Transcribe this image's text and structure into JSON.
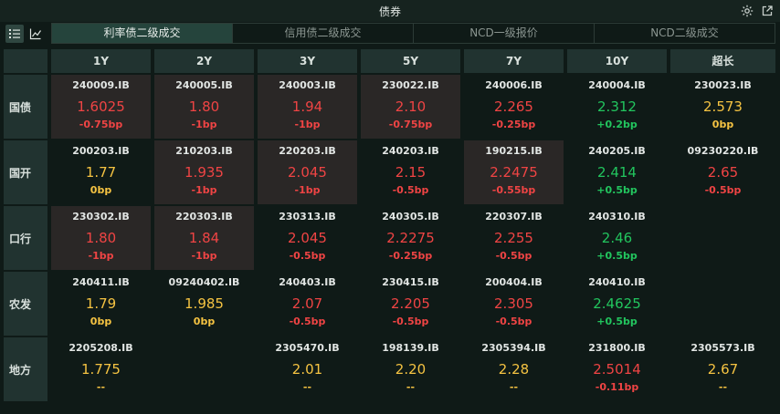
{
  "window": {
    "title": "债券"
  },
  "tabs": [
    {
      "label": "利率债二级成交",
      "active": true
    },
    {
      "label": "信用债二级成交",
      "active": false
    },
    {
      "label": "NCD一级报价",
      "active": false
    },
    {
      "label": "NCD二级成交",
      "active": false
    }
  ],
  "colors": {
    "up": "#ef4444",
    "down": "#22c55e",
    "flat": "#f5c342",
    "background": "#0f1a17",
    "header": "#213330",
    "tab_active": "#25443c"
  },
  "columns": [
    "1Y",
    "2Y",
    "3Y",
    "5Y",
    "7Y",
    "10Y",
    "超长"
  ],
  "rows": [
    {
      "name": "国债",
      "cells": [
        {
          "code": "240009.IB",
          "yield": "1.6025",
          "change": "-0.75bp",
          "trend": "up",
          "highlight": true
        },
        {
          "code": "240005.IB",
          "yield": "1.80",
          "change": "-1bp",
          "trend": "up",
          "highlight": true
        },
        {
          "code": "240003.IB",
          "yield": "1.94",
          "change": "-1bp",
          "trend": "up",
          "highlight": true
        },
        {
          "code": "230022.IB",
          "yield": "2.10",
          "change": "-0.75bp",
          "trend": "up",
          "highlight": true
        },
        {
          "code": "240006.IB",
          "yield": "2.265",
          "change": "-0.25bp",
          "trend": "up",
          "highlight": false
        },
        {
          "code": "240004.IB",
          "yield": "2.312",
          "change": "+0.2bp",
          "trend": "down",
          "highlight": false
        },
        {
          "code": "230023.IB",
          "yield": "2.573",
          "change": "0bp",
          "trend": "flat",
          "highlight": false
        }
      ]
    },
    {
      "name": "国开",
      "cells": [
        {
          "code": "200203.IB",
          "yield": "1.77",
          "change": "0bp",
          "trend": "flat",
          "highlight": false
        },
        {
          "code": "210203.IB",
          "yield": "1.935",
          "change": "-1bp",
          "trend": "up",
          "highlight": true
        },
        {
          "code": "220203.IB",
          "yield": "2.045",
          "change": "-1bp",
          "trend": "up",
          "highlight": true
        },
        {
          "code": "240203.IB",
          "yield": "2.15",
          "change": "-0.5bp",
          "trend": "up",
          "highlight": false
        },
        {
          "code": "190215.IB",
          "yield": "2.2475",
          "change": "-0.55bp",
          "trend": "up",
          "highlight": true
        },
        {
          "code": "240205.IB",
          "yield": "2.414",
          "change": "+0.5bp",
          "trend": "down",
          "highlight": false
        },
        {
          "code": "09230220.IB",
          "yield": "2.65",
          "change": "-0.5bp",
          "trend": "up",
          "highlight": false
        }
      ]
    },
    {
      "name": "口行",
      "cells": [
        {
          "code": "230302.IB",
          "yield": "1.80",
          "change": "-1bp",
          "trend": "up",
          "highlight": true
        },
        {
          "code": "220303.IB",
          "yield": "1.84",
          "change": "-1bp",
          "trend": "up",
          "highlight": true
        },
        {
          "code": "230313.IB",
          "yield": "2.045",
          "change": "-0.5bp",
          "trend": "up",
          "highlight": false
        },
        {
          "code": "240305.IB",
          "yield": "2.2275",
          "change": "-0.25bp",
          "trend": "up",
          "highlight": false
        },
        {
          "code": "220307.IB",
          "yield": "2.255",
          "change": "-0.5bp",
          "trend": "up",
          "highlight": false
        },
        {
          "code": "240310.IB",
          "yield": "2.46",
          "change": "+0.5bp",
          "trend": "down",
          "highlight": false
        },
        null
      ]
    },
    {
      "name": "农发",
      "cells": [
        {
          "code": "240411.IB",
          "yield": "1.79",
          "change": "0bp",
          "trend": "flat",
          "highlight": false
        },
        {
          "code": "09240402.IB",
          "yield": "1.985",
          "change": "0bp",
          "trend": "flat",
          "highlight": false
        },
        {
          "code": "240403.IB",
          "yield": "2.07",
          "change": "-0.5bp",
          "trend": "up",
          "highlight": false
        },
        {
          "code": "230415.IB",
          "yield": "2.205",
          "change": "-0.5bp",
          "trend": "up",
          "highlight": false
        },
        {
          "code": "200404.IB",
          "yield": "2.305",
          "change": "-0.5bp",
          "trend": "up",
          "highlight": false
        },
        {
          "code": "240410.IB",
          "yield": "2.4625",
          "change": "+0.5bp",
          "trend": "down",
          "highlight": false
        },
        null
      ]
    },
    {
      "name": "地方",
      "cells": [
        {
          "code": "2205208.IB",
          "yield": "1.775",
          "change": "--",
          "trend": "flat",
          "highlight": false
        },
        null,
        {
          "code": "2305470.IB",
          "yield": "2.01",
          "change": "--",
          "trend": "flat",
          "highlight": false
        },
        {
          "code": "198139.IB",
          "yield": "2.20",
          "change": "--",
          "trend": "flat",
          "highlight": false
        },
        {
          "code": "2305394.IB",
          "yield": "2.28",
          "change": "--",
          "trend": "flat",
          "highlight": false
        },
        {
          "code": "231800.IB",
          "yield": "2.5014",
          "change": "-0.11bp",
          "trend": "up",
          "highlight": false
        },
        {
          "code": "2305573.IB",
          "yield": "2.67",
          "change": "--",
          "trend": "flat",
          "highlight": false
        }
      ]
    }
  ]
}
